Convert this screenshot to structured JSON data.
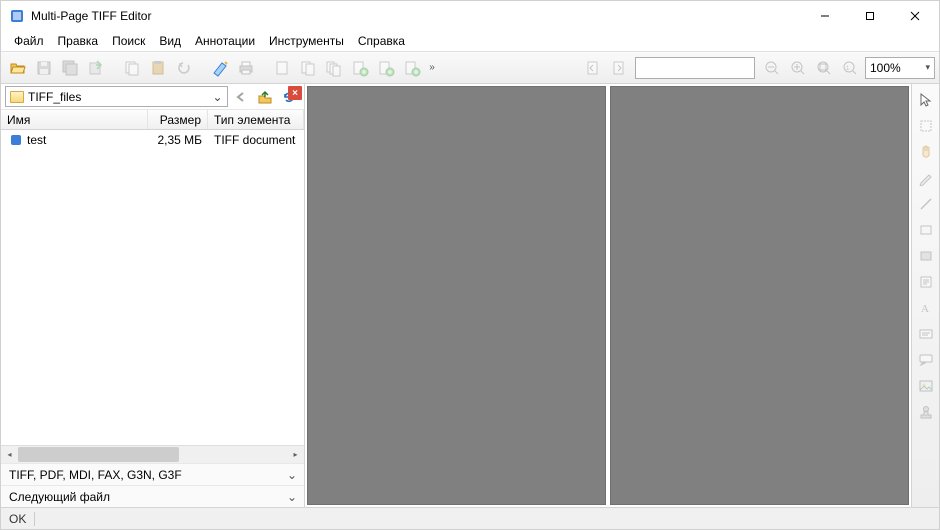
{
  "window": {
    "title": "Multi-Page TIFF Editor"
  },
  "menu": {
    "items": [
      "Файл",
      "Правка",
      "Поиск",
      "Вид",
      "Аннотации",
      "Инструменты",
      "Справка"
    ]
  },
  "toolbar": {
    "open": "open-icon",
    "save": "save-icon",
    "save_all": "save-all-icon",
    "export": "export-icon",
    "copy": "copy-icon",
    "paste": "paste-icon",
    "undo": "undo-icon",
    "scan": "scan-icon",
    "print": "print-icon",
    "page_a": "page-icon",
    "page_b": "page-icon",
    "page_c": "page-icon",
    "add_page1": "add-page-icon",
    "add_page2": "add-page-icon",
    "add_page3": "add-page-icon",
    "more": "»"
  },
  "toolbar2": {
    "prev": "prev-page-icon",
    "next": "next-page-icon",
    "url": "",
    "zoom_out": "zoom-out-icon",
    "zoom_in": "zoom-in-icon",
    "zoom_fit": "zoom-fit-icon",
    "zoom_100": "zoom-100-icon",
    "zoom_val": "100%"
  },
  "sidebar": {
    "path": "TIFF_files",
    "close": "×",
    "columns": {
      "name": "Имя",
      "size": "Размер",
      "type": "Тип элемента"
    },
    "rows": [
      {
        "name": "test",
        "size": "2,35 МБ",
        "type": "TIFF document"
      }
    ],
    "filter": "TIFF, PDF, MDI, FAX, G3N, G3F",
    "next_file": "Следующий файл"
  },
  "right_tools": {
    "items": [
      "cursor-icon",
      "marquee-icon",
      "hand-icon",
      "pencil-icon",
      "line-icon",
      "rect-icon",
      "filled-rect-icon",
      "note-icon",
      "text-icon",
      "textbox-icon",
      "callout-icon",
      "image-icon",
      "stamp-icon"
    ]
  },
  "status": {
    "ok": "OK"
  }
}
